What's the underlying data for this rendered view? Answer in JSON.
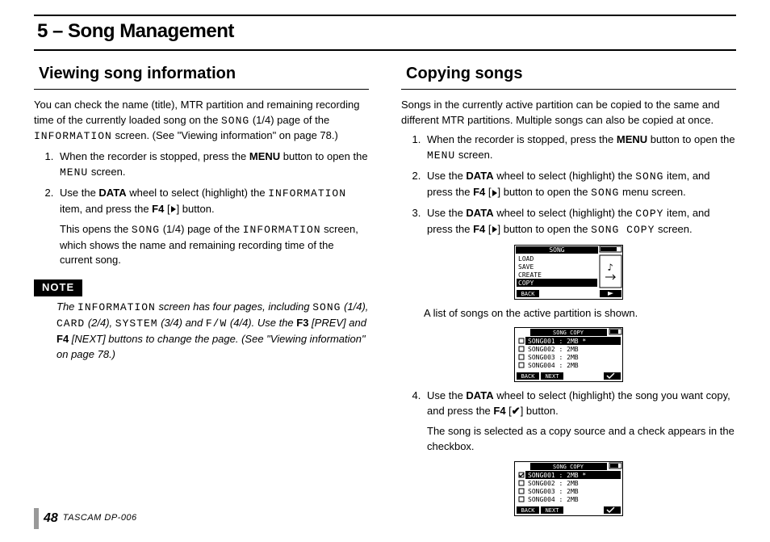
{
  "chapter": "5 – Song Management",
  "left": {
    "heading": "Viewing song information",
    "intro_a": "You can check the name (title), MTR partition and remaining recording time of the currently loaded song on the ",
    "intro_b": " (1/4) page of the ",
    "intro_c": " screen. (See \"Viewing information\" on page 78.)",
    "step1_a": "When the recorder is stopped, press the ",
    "step1_menuBtn": "MENU",
    "step1_b": " button to open the ",
    "step1_c": " screen.",
    "step2_a": "Use the ",
    "step2_dataBtn": "DATA",
    "step2_b": " wheel to select (highlight) the ",
    "step2_c": " item, and press the ",
    "step2_f4": "F4",
    "step2_d": " [",
    "step2_e": "] button.",
    "step2_open_a": "This opens the ",
    "step2_open_b": " (1/4) page of the ",
    "step2_open_c": " screen, which shows the name and remaining recording time of the current song.",
    "note_label": "NOTE",
    "note_a": "The ",
    "note_b": " screen has four pages, including ",
    "note_c": " (1/4), ",
    "note_d": " (2/4), ",
    "note_e": " (3/4) and ",
    "note_f": " (4/4). Use the ",
    "note_f3": "F3",
    "note_g": " [PREV] and ",
    "note_f4": "F4",
    "note_h": " [NEXT] buttons to change the page. (See \"Viewing information\" on page 78.)"
  },
  "right": {
    "heading": "Copying songs",
    "intro": "Songs in the currently active partition can be copied to the same and different MTR partitions. Multiple songs can also be copied at once.",
    "step1_a": "When the recorder is stopped, press the ",
    "step1_menuBtn": "MENU",
    "step1_b": " button to open the ",
    "step1_c": " screen.",
    "step2_a": "Use the ",
    "step2_dataBtn": "DATA",
    "step2_b": " wheel to select (highlight) the ",
    "step2_c": " item, and press the ",
    "step2_f4": "F4",
    "step2_d": " [",
    "step2_e": "] button to open the ",
    "step2_f": " menu screen.",
    "step3_a": "Use the ",
    "step3_dataBtn": "DATA",
    "step3_b": " wheel to select (highlight) the ",
    "step3_c": " item, and press the ",
    "step3_f4": "F4",
    "step3_d": " [",
    "step3_e": "] button to open the ",
    "step3_f": " screen.",
    "caption1": "A list of songs on the active partition is shown.",
    "step4_a": "Use the ",
    "step4_dataBtn": "DATA",
    "step4_b": " wheel to select (highlight) the song you want copy, and press the ",
    "step4_f4": "F4",
    "step4_c": " [",
    "step4_d": "] button.",
    "step4_result": "The song is selected as a copy source and a check appears in the checkbox."
  },
  "lcd": {
    "SONG": "SONG",
    "INFORMATION": "INFORMATION",
    "MENU": "MENU",
    "CARD": "CARD",
    "SYSTEM": "SYSTEM",
    "FW": "F/W",
    "COPY": "COPY",
    "SONG_COPY": "SONG COPY",
    "menu_items": [
      "LOAD",
      "SAVE",
      "CREATE",
      "COPY"
    ],
    "back": "BACK",
    "next": "NEXT",
    "songs": [
      {
        "name": "SONG001",
        "size": "2MB",
        "star": true
      },
      {
        "name": "SONG002",
        "size": "2MB",
        "star": false
      },
      {
        "name": "SONG003",
        "size": "2MB",
        "star": false
      },
      {
        "name": "SONG004",
        "size": "2MB",
        "star": false
      }
    ]
  },
  "footer": {
    "page": "48",
    "model": "TASCAM  DP-006"
  }
}
